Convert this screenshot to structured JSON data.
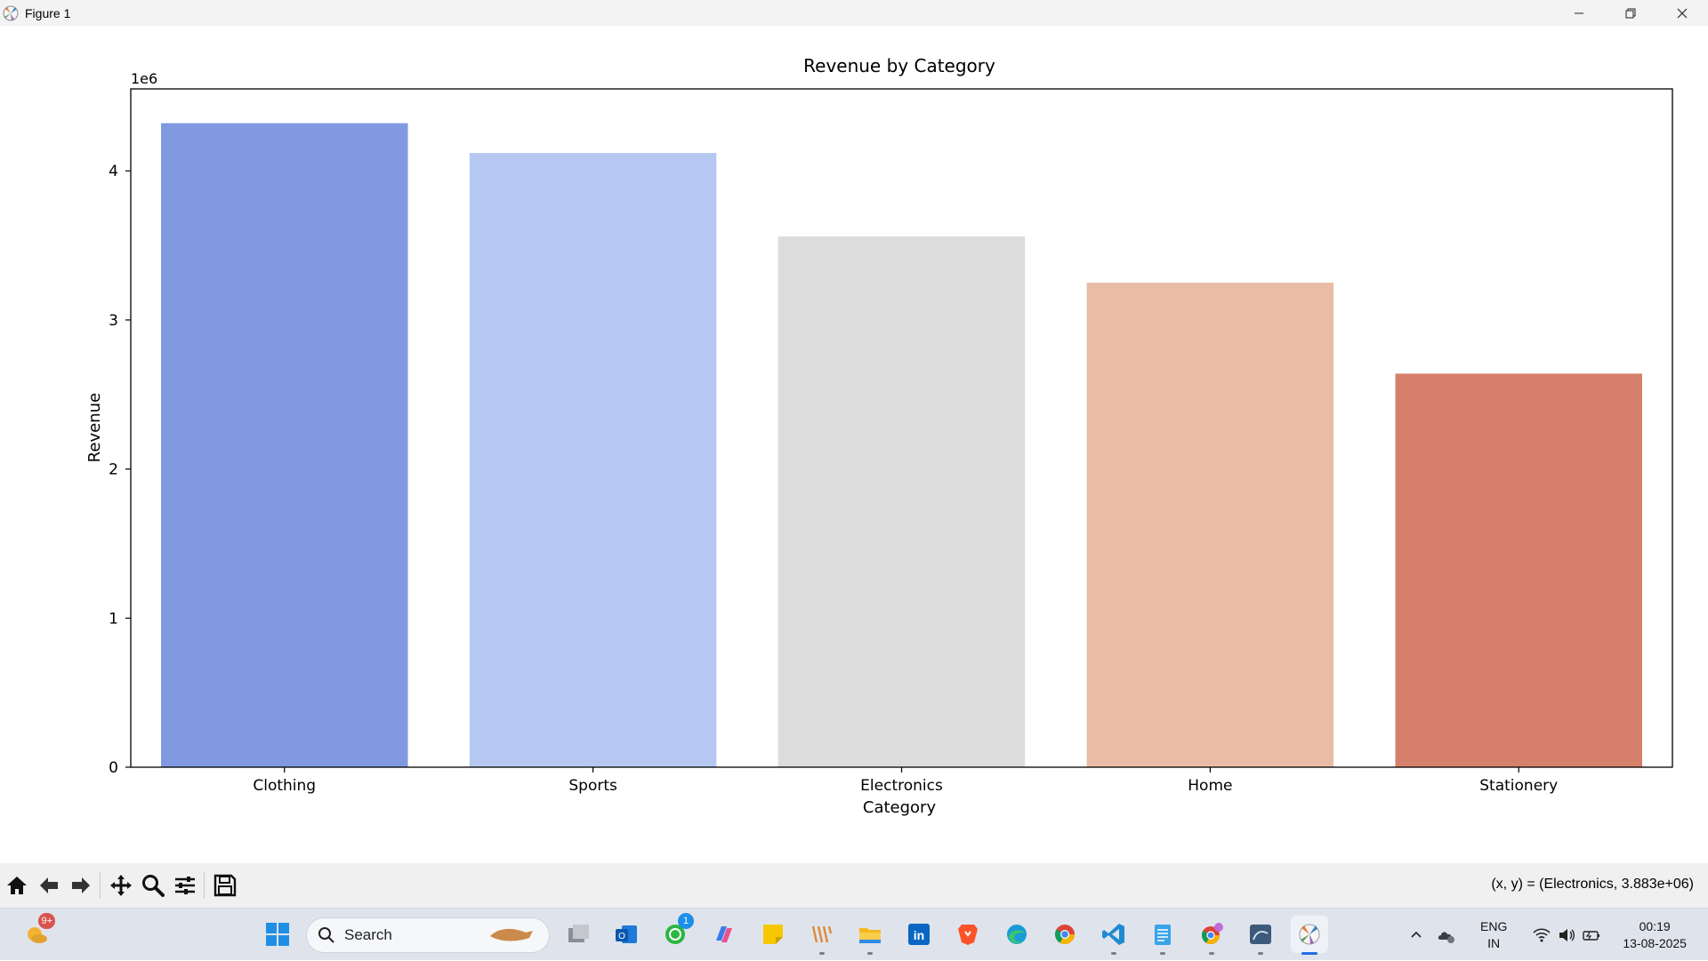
{
  "window": {
    "title": "Figure 1",
    "controls": [
      "minimize",
      "restore",
      "close"
    ]
  },
  "chart_data": {
    "type": "bar",
    "title": "Revenue by Category",
    "xlabel": "Category",
    "ylabel": "Revenue",
    "offset_label": "1e6",
    "categories": [
      "Clothing",
      "Sports",
      "Electronics",
      "Home",
      "Stationery"
    ],
    "values": [
      4320000,
      4120000,
      3560000,
      3250000,
      2640000
    ],
    "colors": [
      "#8099e1",
      "#b6c8f2",
      "#dcdcdc",
      "#eabca6",
      "#d6806c"
    ],
    "ylim": [
      0,
      4550000
    ],
    "yticks": [
      0,
      1,
      2,
      3,
      4
    ],
    "ytick_scale": 1000000,
    "grid": false,
    "legend": false
  },
  "toolbar": {
    "tools": [
      "home-icon",
      "back-icon",
      "forward-icon",
      "pan-icon",
      "zoom-icon",
      "configure-subplots-icon",
      "save-icon"
    ],
    "coords_text": "(x, y) = (Electronics, 3.883e+06)"
  },
  "taskbar": {
    "search_placeholder": "Search",
    "weather_badge": "9+",
    "whatsapp_badge": "1",
    "language": "ENG",
    "region": "IN",
    "time": "00:19",
    "date": "13-08-2025",
    "apps": [
      "weather-icon",
      "start-icon",
      "task-view-icon",
      "outlook-icon",
      "whatsapp-icon",
      "copilot-icon",
      "sticky-notes-icon",
      "winamp-icon",
      "file-explorer-icon",
      "linkedin-icon",
      "brave-icon",
      "edge-icon",
      "chrome-icon",
      "vscode-icon",
      "notepad-icon",
      "chrome-profile-icon",
      "mysql-workbench-icon",
      "python-figure-icon"
    ]
  }
}
